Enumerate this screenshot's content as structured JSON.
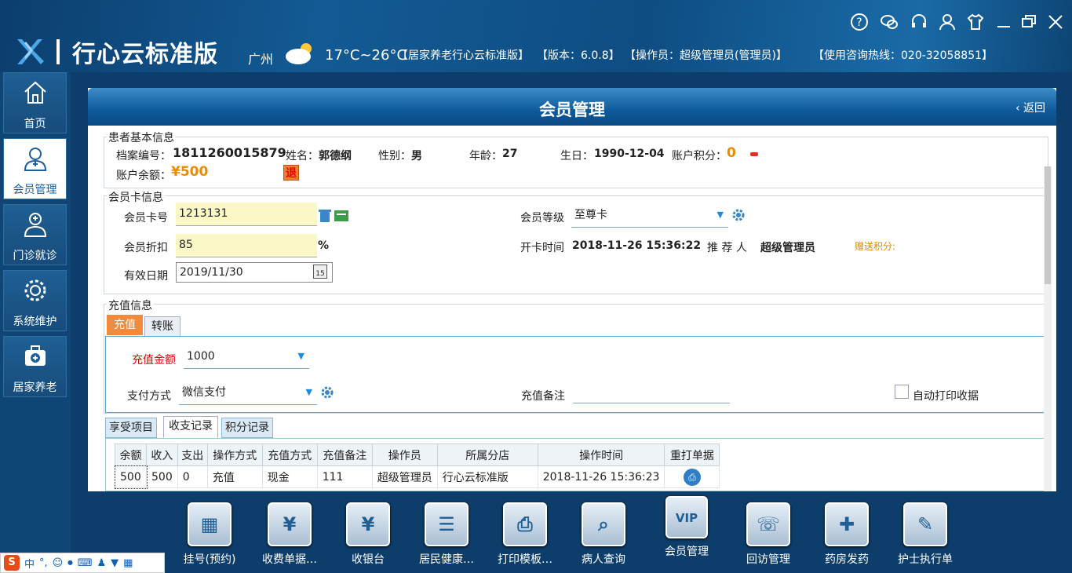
{
  "app": {
    "title": "行心云标准版",
    "city": "广州",
    "temp": "17°C~26°C",
    "desc": "【居家养老行心云标准版】",
    "version": "【版本：6.0.8】",
    "operator": "【操作员：超级管理员(管理员)】",
    "hotline": "【使用咨询热线：020-32058851】"
  },
  "top_icons": [
    "help-icon",
    "wechat-icon",
    "headset-icon",
    "user-icon",
    "skin-icon",
    "minimize-icon",
    "restore-icon",
    "close-icon"
  ],
  "sidebar": {
    "items": [
      {
        "label": "首页",
        "icon": "home-icon"
      },
      {
        "label": "会员管理",
        "icon": "member-icon",
        "active": true
      },
      {
        "label": "门诊就诊",
        "icon": "doctor-icon"
      },
      {
        "label": "系统维护",
        "icon": "gear-icon"
      },
      {
        "label": "居家养老",
        "icon": "medkit-icon"
      }
    ]
  },
  "page": {
    "title": "会员管理",
    "back": "返回"
  },
  "patient": {
    "section": "患者基本信息",
    "id_label": "档案编号：",
    "id": "1811260015879",
    "name_label": "姓名：",
    "name": "郭德纲",
    "sex_label": "性别：",
    "sex": "男",
    "age_label": "年龄：",
    "age": "27",
    "birth_label": "生日：",
    "birth": "1990-12-04",
    "points_label": "账户积分：",
    "points": "0",
    "balance_label": "账户余额：",
    "balance": "¥500",
    "refund": "退"
  },
  "card": {
    "section": "会员卡信息",
    "no_label": "会员卡号",
    "no": "1213131",
    "level_label": "会员等级",
    "level": "至尊卡",
    "discount_label": "会员折扣",
    "discount": "85",
    "pct": "%",
    "open_label": "开卡时间",
    "open": "2018-11-26 15:36:22",
    "ref_label": "推 荐 人",
    "ref": "超级管理员",
    "gift_label": "赠送积分:",
    "expire_label": "有效日期",
    "expire": "2019/11/30",
    "cal": "15"
  },
  "recharge": {
    "section": "充值信息",
    "tabs": [
      "充值",
      "转账"
    ],
    "amount_label": "充值金额",
    "amount": "1000",
    "pay_label": "支付方式",
    "pay": "微信支付",
    "note_label": "充值备注",
    "note": "",
    "auto_print": "自动打印收据"
  },
  "records": {
    "tabs": [
      "享受项目",
      "收支记录",
      "积分记录"
    ],
    "headers": [
      "余额",
      "收入",
      "支出",
      "操作方式",
      "充值方式",
      "充值备注",
      "操作员",
      "所属分店",
      "操作时间",
      "重打单据"
    ],
    "rows": [
      [
        "500",
        "500",
        "0",
        "充值",
        "现金",
        "111",
        "超级管理员",
        "行心云标准版",
        "2018-11-26 15:36:23",
        ""
      ]
    ]
  },
  "dock": [
    {
      "label": "挂号(预约)",
      "icon": "calendar-icon"
    },
    {
      "label": "收费单据…",
      "icon": "cash-register-icon"
    },
    {
      "label": "收银台",
      "icon": "cashier-icon"
    },
    {
      "label": "居民健康…",
      "icon": "health-card-icon"
    },
    {
      "label": "打印模板…",
      "icon": "printer-icon"
    },
    {
      "label": "病人查询",
      "icon": "patient-search-icon"
    },
    {
      "label": "会员管理",
      "icon": "vip-icon"
    },
    {
      "label": "回访管理",
      "icon": "callback-icon"
    },
    {
      "label": "药房发药",
      "icon": "pharmacy-icon"
    },
    {
      "label": "护士执行单",
      "icon": "nurse-order-icon"
    }
  ],
  "ime": {
    "label": "中"
  }
}
